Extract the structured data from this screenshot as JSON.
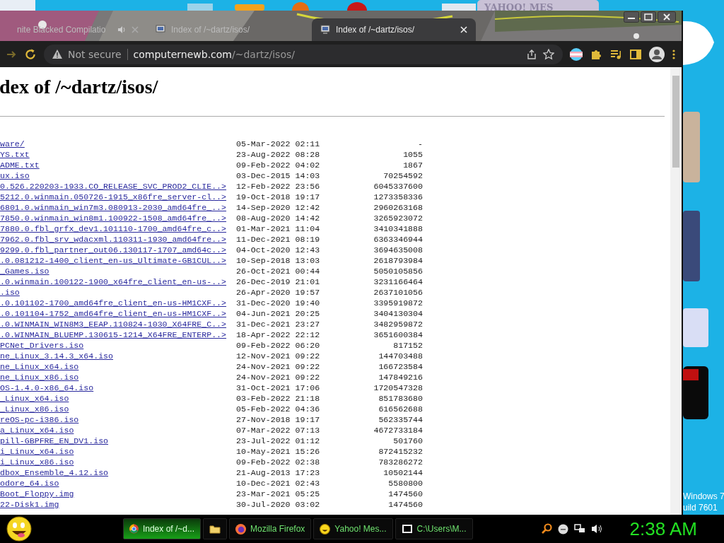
{
  "desktop": {
    "build_lines": [
      "Windows 7",
      "uild 7601"
    ]
  },
  "background_window": {
    "title": "YAHOO! MES"
  },
  "browser": {
    "tabs": [
      {
        "title": "nite Blacked Compilatio",
        "selected": false,
        "audio": true,
        "show_close": true
      },
      {
        "title": "Index of /~dartz/isos/",
        "selected": false,
        "audio": false,
        "show_close": false
      },
      {
        "title": "Index of /~dartz/isos/",
        "selected": true,
        "audio": false,
        "show_close": true
      }
    ],
    "address_bar": {
      "security": "Not secure",
      "domain": "computernewb.com",
      "path": "/~dartz/isos/"
    }
  },
  "page": {
    "heading": "dex of /~dartz/isos/",
    "rows": [
      {
        "name": "ware/",
        "date": "05-Mar-2022 02:11",
        "size": "-"
      },
      {
        "name": "YS.txt",
        "date": "23-Aug-2022 08:28",
        "size": "1055"
      },
      {
        "name": "ADME.txt",
        "date": "09-Feb-2022 04:02",
        "size": "1867"
      },
      {
        "name": "ux.iso",
        "date": "03-Dec-2015 14:03",
        "size": "70254592"
      },
      {
        "name": "0.526.220203-1933.CO_RELEASE_SVC_PROD2_CLIE..>",
        "date": "12-Feb-2022 23:56",
        "size": "6045337600"
      },
      {
        "name": "5212.0.winmain.050726-1915_x86fre_server-cl..>",
        "date": "19-Oct-2018 19:17",
        "size": "1273358336"
      },
      {
        "name": "6801.0.winmain_win7m3.080913-2030_amd64fre_..>",
        "date": "14-Sep-2020 12:42",
        "size": "2960263168"
      },
      {
        "name": "7850.0.winmain_win8m1.100922-1508_amd64fre_..>",
        "date": "08-Aug-2020 14:42",
        "size": "3265923072"
      },
      {
        "name": "7880.0.fbl_grfx_dev1.101110-1700_amd64fre_c..>",
        "date": "01-Mar-2021 11:04",
        "size": "3410341888"
      },
      {
        "name": "7962.0.fbl_srv_wdacxml.110311-1930_amd64fre..>",
        "date": "11-Dec-2021 08:19",
        "size": "6363346944"
      },
      {
        "name": "9299.0.fbl_partner_out06.130117-1707_amd64c..>",
        "date": "04-Oct-2020 12:43",
        "size": "3694635008"
      },
      {
        "name": ".0.081212-1400_client_en-us_Ultimate-GB1CUL..>",
        "date": "10-Sep-2018 13:03",
        "size": "2618793984"
      },
      {
        "name": "_Games.iso",
        "date": "26-Oct-2021 00:44",
        "size": "5050105856"
      },
      {
        "name": ".0.winmain.100122-1900_x64fre_client_en-us-..>",
        "date": "26-Dec-2019 21:01",
        "size": "3231166464"
      },
      {
        "name": ".iso",
        "date": "26-Apr-2020 19:57",
        "size": "2637101056"
      },
      {
        "name": ".0.101102-1700_amd64fre_client_en-us-HM1CXF..>",
        "date": "31-Dec-2020 19:40",
        "size": "3395919872"
      },
      {
        "name": ".0.101104-1752_amd64fre_client_en-us-HM1CXF..>",
        "date": "04-Jun-2021 20:25",
        "size": "3404130304"
      },
      {
        "name": ".0.WINMAIN_WIN8M3_EEAP.110824-1030_X64FRE_C..>",
        "date": "31-Dec-2021 23:27",
        "size": "3482959872"
      },
      {
        "name": ".0.WINMAIN_BLUEMP.130615-1214_X64FRE_ENTERP..>",
        "date": "18-Apr-2022 22:12",
        "size": "3651600384"
      },
      {
        "name": "PCNet_Drivers.iso",
        "date": "09-Feb-2022 06:20",
        "size": "817152"
      },
      {
        "name": "ne_Linux_3.14.3_x64.iso",
        "date": "12-Nov-2021 09:22",
        "size": "144703488"
      },
      {
        "name": "ne_Linux_x64.iso",
        "date": "24-Nov-2021 09:22",
        "size": "166723584"
      },
      {
        "name": "ne_Linux_x86.iso",
        "date": "24-Nov-2021 09:22",
        "size": "147849216"
      },
      {
        "name": "OS-1.4.0-x86_64.iso",
        "date": "31-Oct-2021 17:06",
        "size": "1720547328"
      },
      {
        "name": "_Linux_x64.iso",
        "date": "03-Feb-2022 21:18",
        "size": "851783680"
      },
      {
        "name": "_Linux_x86.iso",
        "date": "05-Feb-2022 04:36",
        "size": "616562688"
      },
      {
        "name": "reOS-pc-i386.iso",
        "date": "27-Nov-2018 19:17",
        "size": "562335744"
      },
      {
        "name": "a_Linux_x64.iso",
        "date": "07-Mar-2022 07:13",
        "size": "4672733184"
      },
      {
        "name": "pill-GBPFRE_EN_DV1.iso",
        "date": "23-Jul-2022 01:12",
        "size": "501760"
      },
      {
        "name": "i_Linux_x64.iso",
        "date": "10-May-2021 15:26",
        "size": "872415232"
      },
      {
        "name": "i_Linux_x86.iso",
        "date": "09-Feb-2022 02:38",
        "size": "783286272"
      },
      {
        "name": "dbox_Ensemble_4.12.iso",
        "date": "21-Aug-2013 17:23",
        "size": "10502144"
      },
      {
        "name": "odore_64.iso",
        "date": "10-Dec-2021 02:43",
        "size": "5580800"
      },
      {
        "name": "Boot_Floppy.img",
        "date": "23-Mar-2021 05:25",
        "size": "1474560"
      },
      {
        "name": "22-Disk1.img",
        "date": "30-Jul-2020 03:02",
        "size": "1474560"
      }
    ]
  },
  "taskbar": {
    "buttons": [
      {
        "kind": "chrome",
        "label": "Index of /~d...",
        "selected": true
      },
      {
        "kind": "folder",
        "selected": false
      },
      {
        "kind": "firefox",
        "label": "Mozilla Firefox",
        "selected": false
      },
      {
        "kind": "yahoo",
        "label": "Yahoo! Mes...",
        "selected": false
      },
      {
        "kind": "sevenzip",
        "label": "C:\\Users\\M...",
        "selected": false
      }
    ],
    "clock": "2:38 AM"
  }
}
